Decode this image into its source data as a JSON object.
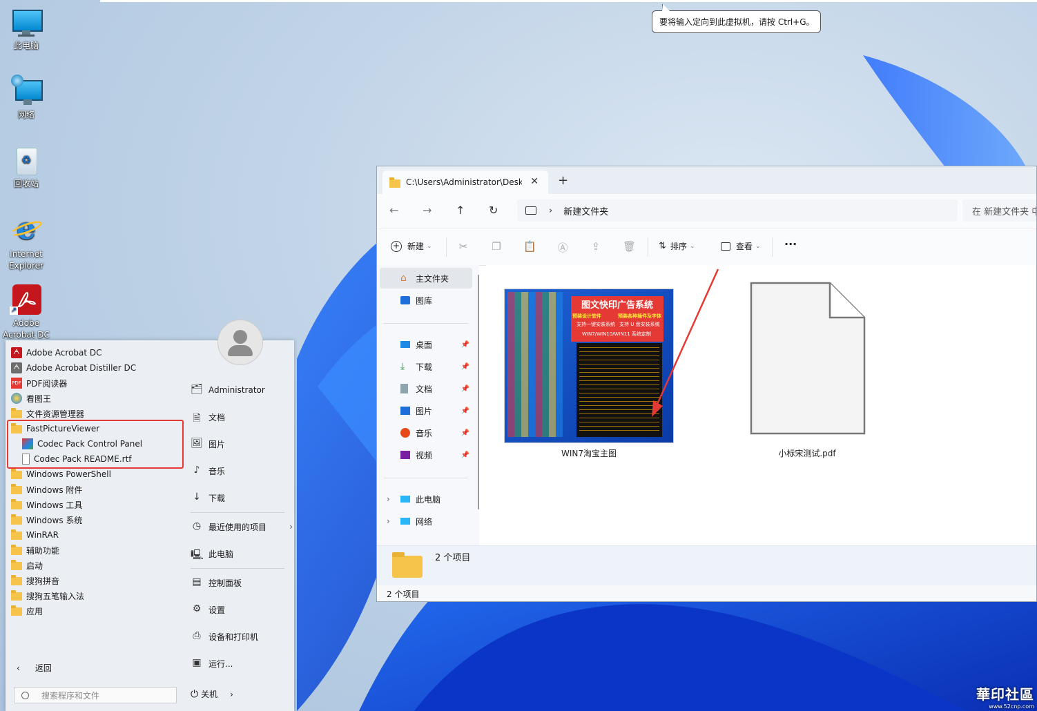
{
  "desktop": {
    "icons": [
      {
        "label": "此电脑"
      },
      {
        "label": "网络"
      },
      {
        "label": "回收站"
      },
      {
        "label": "Internet Explorer"
      },
      {
        "label": "Adobe Acrobat DC"
      }
    ]
  },
  "tooltip": {
    "text": "要将输入定向到此虚拟机，请按 Ctrl+G。"
  },
  "explorer": {
    "tab_title": "C:\\Users\\Administrator\\Deskt",
    "breadcrumb": "新建文件夹",
    "search_placeholder": "在 新建文件夹 中",
    "toolbar": {
      "new": "新建",
      "sort": "排序",
      "view": "查看",
      "more": "···"
    },
    "nav": {
      "home": "主文件夹",
      "gallery": "图库",
      "pinned": [
        "桌面",
        "下载",
        "文档",
        "图片",
        "音乐",
        "视频"
      ],
      "pc": "此电脑",
      "network": "网络"
    },
    "files": [
      {
        "name": "WIN7淘宝主图"
      },
      {
        "name": "小标宋测试.pdf"
      }
    ],
    "thumb": {
      "headline": "图文快印广告系统",
      "lines": [
        "预装设计软件",
        "预装各种插件及字体",
        "支持一键安装系统",
        "支持 U 盘安装系统",
        "WIN7/WIN10/WIN11 系统定制"
      ]
    },
    "details_count": "2 个项目",
    "status": "2 个项目"
  },
  "startmenu": {
    "programs": [
      {
        "label": "Adobe Acrobat DC",
        "type": "acrobat"
      },
      {
        "label": "Adobe Acrobat Distiller DC",
        "type": "distiller"
      },
      {
        "label": "PDF阅读器",
        "type": "pdf"
      },
      {
        "label": "看图王",
        "type": "viewer"
      },
      {
        "label": "文件资源管理器",
        "type": "folder"
      },
      {
        "label": "FastPictureViewer",
        "type": "folder"
      },
      {
        "label": "Codec Pack Control Panel",
        "type": "codec",
        "sub": true
      },
      {
        "label": "Codec Pack README.rtf",
        "type": "doc",
        "sub": true
      },
      {
        "label": "Windows PowerShell",
        "type": "folder"
      },
      {
        "label": "Windows 附件",
        "type": "folder"
      },
      {
        "label": "Windows 工具",
        "type": "folder"
      },
      {
        "label": "Windows 系统",
        "type": "folder"
      },
      {
        "label": "WinRAR",
        "type": "folder"
      },
      {
        "label": "辅助功能",
        "type": "folder"
      },
      {
        "label": "启动",
        "type": "folder"
      },
      {
        "label": "搜狗拼音",
        "type": "folder"
      },
      {
        "label": "搜狗五笔输入法",
        "type": "folder"
      },
      {
        "label": "应用",
        "type": "folder"
      }
    ],
    "right": {
      "user": "Administrator",
      "documents": "文档",
      "pictures": "图片",
      "music": "音乐",
      "downloads": "下载",
      "recent": "最近使用的项目",
      "pc": "此电脑",
      "control": "控制面板",
      "settings": "设置",
      "devices": "设备和打印机",
      "run": "运行..."
    },
    "back": "返回",
    "search_placeholder": "搜索程序和文件",
    "shutdown": "关机"
  },
  "watermark": {
    "title": "華印社區",
    "url": "www.52cnp.com"
  }
}
